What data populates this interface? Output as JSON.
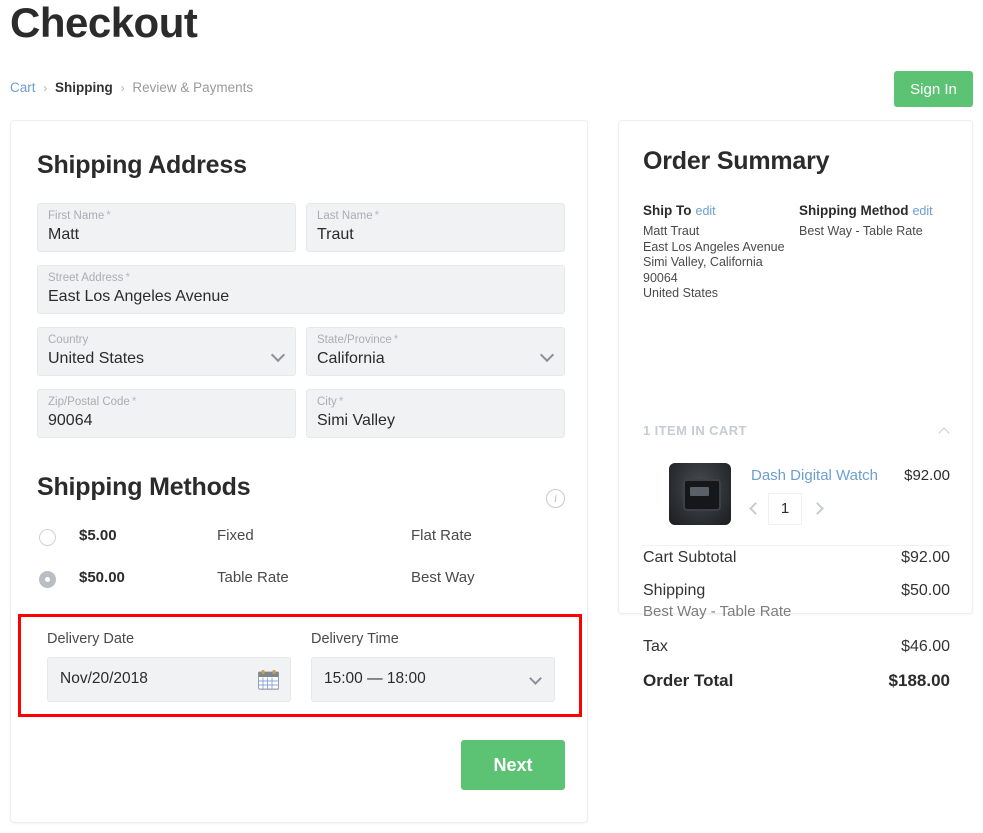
{
  "header": {
    "title": "Checkout",
    "breadcrumb": {
      "cart": "Cart",
      "sep": "›",
      "shipping": "Shipping",
      "review": "Review & Payments"
    },
    "sign_in_label": "Sign In"
  },
  "shipping_address": {
    "title": "Shipping Address",
    "fields": [
      {
        "label": "First Name",
        "required": "*",
        "value": "Matt"
      },
      {
        "label": "Last Name",
        "required": "*",
        "value": "Traut"
      },
      {
        "label": "Street Address",
        "required": "*",
        "value": "East Los Angeles Avenue"
      },
      {
        "label": "Country",
        "required": "",
        "value": "United States"
      },
      {
        "label": "State/Province",
        "required": "*",
        "value": "California"
      },
      {
        "label": "Zip/Postal Code",
        "required": "*",
        "value": "90064"
      },
      {
        "label": "City",
        "required": "*",
        "value": "Simi Valley"
      }
    ]
  },
  "shipping_methods": {
    "title": "Shipping Methods",
    "options": [
      {
        "price": "$5.00",
        "method": "Fixed",
        "carrier": "Flat Rate",
        "selected": false
      },
      {
        "price": "$50.00",
        "method": "Table Rate",
        "carrier": "Best Way",
        "selected": true
      }
    ]
  },
  "delivery": {
    "date_label": "Delivery Date",
    "date_value": "Nov/20/2018",
    "time_label": "Delivery Time",
    "time_value": "15:00 — 18:00",
    "highlight_color": "#ff0000"
  },
  "next_button_label": "Next",
  "order_summary": {
    "title": "Order Summary",
    "ship_to": {
      "heading": "Ship To",
      "edit": "edit",
      "line1": "Matt Traut",
      "line2": "East Los Angeles Avenue",
      "line3": "Simi Valley, California 90064",
      "line4": "United States"
    },
    "shipping_method": {
      "heading": "Shipping Method",
      "edit": "edit",
      "value": "Best Way - Table Rate"
    },
    "cart_toggle_label": "1 ITEM IN CART",
    "item": {
      "name": "Dash Digital Watch",
      "price": "$92.00",
      "qty": "1"
    },
    "totals": {
      "subtotal_label": "Cart Subtotal",
      "subtotal_value": "$92.00",
      "shipping_label": "Shipping",
      "shipping_value": "$50.00",
      "shipping_sub": "Best Way - Table Rate",
      "tax_label": "Tax",
      "tax_value": "$46.00",
      "total_label": "Order Total",
      "total_value": "$188.00"
    }
  },
  "colors": {
    "accent_green": "#5cc374",
    "link_blue": "#6c9fd0",
    "field_bg": "#f0f2f4"
  }
}
